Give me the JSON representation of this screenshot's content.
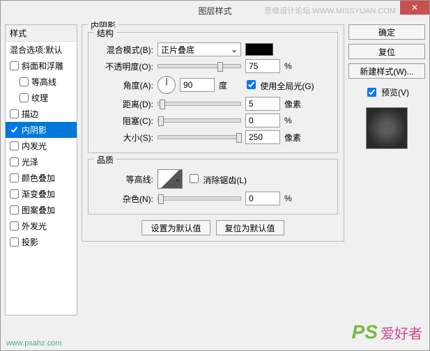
{
  "window": {
    "title": "图层样式"
  },
  "watermark": {
    "top": "思缘设计论坛  WWW.MISSYUAN.COM",
    "url": "www.psahz.com"
  },
  "logo": {
    "ps": "PS",
    "cn": "爱好者"
  },
  "close": {
    "glyph": "✕"
  },
  "styles_panel": {
    "header": "样式",
    "blend": "混合选项:默认",
    "items": [
      {
        "label": "斜面和浮雕",
        "checked": false
      },
      {
        "label": "等高线",
        "checked": false,
        "indent": true
      },
      {
        "label": "纹理",
        "checked": false,
        "indent": true
      },
      {
        "label": "描边",
        "checked": false
      },
      {
        "label": "内阴影",
        "checked": true,
        "selected": true
      },
      {
        "label": "内发光",
        "checked": false
      },
      {
        "label": "光泽",
        "checked": false
      },
      {
        "label": "颜色叠加",
        "checked": false
      },
      {
        "label": "渐变叠加",
        "checked": false
      },
      {
        "label": "图案叠加",
        "checked": false
      },
      {
        "label": "外发光",
        "checked": false
      },
      {
        "label": "投影",
        "checked": false
      }
    ]
  },
  "main": {
    "group_title": "内阴影",
    "structure": {
      "title": "结构",
      "blend_mode_label": "混合模式(B):",
      "blend_mode_value": "正片叠底",
      "opacity_label": "不透明度(O):",
      "opacity_value": "75",
      "opacity_unit": "%",
      "angle_label": "角度(A):",
      "angle_value": "90",
      "angle_unit": "度",
      "global_light": "使用全局光(G)",
      "distance_label": "距离(D):",
      "distance_value": "5",
      "distance_unit": "像素",
      "choke_label": "阻塞(C):",
      "choke_value": "0",
      "choke_unit": "%",
      "size_label": "大小(S):",
      "size_value": "250",
      "size_unit": "像素"
    },
    "quality": {
      "title": "品质",
      "contour_label": "等高线:",
      "antialias": "消除锯齿(L)",
      "noise_label": "杂色(N):",
      "noise_value": "0",
      "noise_unit": "%"
    },
    "buttons": {
      "default": "设置为默认值",
      "reset": "复位为默认值"
    }
  },
  "right": {
    "ok": "确定",
    "cancel": "复位",
    "new_style": "新建样式(W)...",
    "preview": "预览(V)"
  },
  "chevron": "⌄"
}
